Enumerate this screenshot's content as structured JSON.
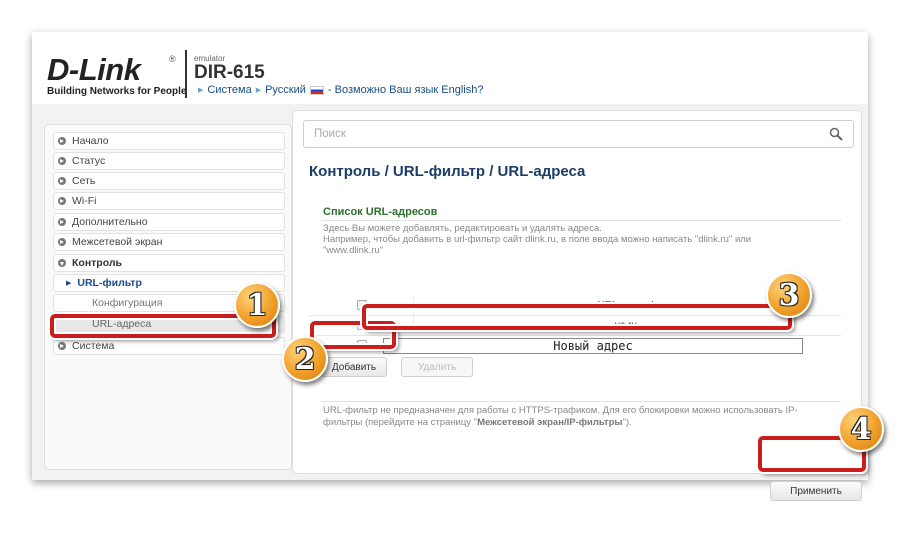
{
  "header": {
    "logo": "D-Link",
    "registered": "®",
    "tagline": "Building Networks for People",
    "emulator": "emulator",
    "model": "DIR-615",
    "crumb_system": "Система",
    "crumb_language": "Русский",
    "language_prompt": "- Возможно Ваш язык English?"
  },
  "sidebar": {
    "items": [
      {
        "label": "Начало"
      },
      {
        "label": "Статус"
      },
      {
        "label": "Сеть"
      },
      {
        "label": "Wi-Fi"
      },
      {
        "label": "Дополнительно"
      },
      {
        "label": "Межсетевой экран"
      },
      {
        "label": "Контроль"
      },
      {
        "label": "URL-фильтр"
      },
      {
        "label": "Конфигурация"
      },
      {
        "label": "URL-адреса"
      },
      {
        "label": "Система"
      }
    ]
  },
  "search": {
    "placeholder": "Поиск"
  },
  "page": {
    "title": "Контроль /  URL-фильтр /  URL-адреса",
    "section_title": "Список URL-адресов",
    "desc_line1": "Здесь Вы можете добавлять, редактировать и удалять адреса.",
    "desc_line2": "Например, чтобы добавить в url-фильтр сайт dlink.ru, в поле ввода можно написать \"dlink.ru\" или \"www.dlink.ru\"",
    "table_header": "URL-адрес",
    "table_required": "*",
    "rows": [
      {
        "url": "ya.ru"
      }
    ],
    "new_value": "Новый адрес",
    "add_button": "Добавить",
    "delete_button": "Удалить",
    "note_text": "URL-фильтр не предназначен для работы с HTTPS-трафиком. Для его блокировки можно использовать IP-фильтры (перейдите на страницу \"",
    "note_link": "Межсетевой экран/IP-фильтры",
    "note_end": "\").",
    "apply_button": "Применить"
  },
  "callouts": [
    "1",
    "2",
    "3",
    "4"
  ],
  "colors": {
    "highlight": "#cc1d1d",
    "badge": "#f0a02a",
    "title": "#1a3e66",
    "section": "#2f6f2f"
  }
}
